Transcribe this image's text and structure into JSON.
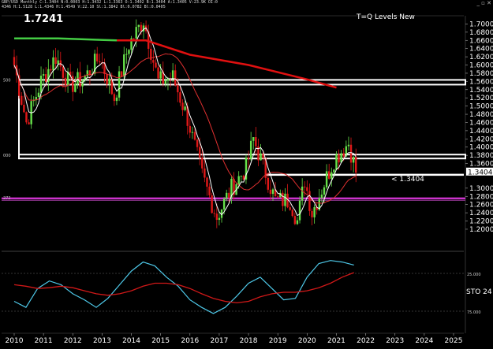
{
  "window": {
    "header_line1": "GBP/USD Monthly  C:1.3404 N:0.0003 H:1.3432 L:1.3363 O:1.3402 B:1.3404 A:1.3405 V:23.9K OI:0",
    "header_line2": "4346  H:1.5128  L:1.4346  H:1.4549  V:22.10 Sl:1.3842  Bl:0.0782  Bl:0.0405",
    "big_price": "1.7241",
    "title": "T=Q Levels New",
    "buttons": "_ ▫ ✕"
  },
  "colors": {
    "background": "#000000",
    "bull": "#66e04a",
    "bear": "#e01818",
    "ma_long": "#e01010",
    "ma_short": "#ffffff",
    "ma_mid": "#e03030",
    "green_ma": "#44cc44",
    "level_box": "#ffffff",
    "magenta_level": "#cc33cc",
    "stoch_k": "#4ec8e8",
    "stoch_d": "#d01818"
  },
  "chart_data": [
    {
      "type": "candlestick",
      "title": "T=Q Levels New",
      "symbol": "GBP/USD Monthly",
      "ylim": [
        1.15,
        1.72
      ],
      "y_ticks": [
        "1.7000",
        "1.6800",
        "1.6600",
        "1.6400",
        "1.6200",
        "1.6000",
        "1.5800",
        "1.5600",
        "1.5400",
        "1.5200",
        "1.5000",
        "1.4800",
        "1.4600",
        "1.4400",
        "1.4200",
        "1.4000",
        "1.3800",
        "1.3600",
        "1.3404",
        "1.3000",
        "1.2800",
        "1.2600",
        "1.2400",
        "1.2200",
        "1.2000"
      ],
      "x_ticks": [
        "2010",
        "2011",
        "2012",
        "2013",
        "2014",
        "2015",
        "2016",
        "2017",
        "2018",
        "2019",
        "2020",
        "2021",
        "2022",
        "2023",
        "2024",
        "2025"
      ],
      "last_price": 1.3404,
      "last_price_label": "< 1.3404",
      "levels": [
        {
          "name": "resistance",
          "value": 1.558,
          "left_label": "500"
        },
        {
          "name": "mid",
          "value": 1.378,
          "left_label": "000"
        },
        {
          "name": "support",
          "value": 1.275,
          "left_label": "272"
        }
      ],
      "yearly_close_path": [
        [
          "2010-01",
          1.6
        ],
        [
          "2010-06",
          1.46
        ],
        [
          "2010-12",
          1.56
        ],
        [
          "2011-06",
          1.62
        ],
        [
          "2011-12",
          1.55
        ],
        [
          "2012-06",
          1.57
        ],
        [
          "2012-12",
          1.62
        ],
        [
          "2013-06",
          1.52
        ],
        [
          "2013-12",
          1.65
        ],
        [
          "2014-06",
          1.71
        ],
        [
          "2014-12",
          1.56
        ],
        [
          "2015-06",
          1.57
        ],
        [
          "2015-12",
          1.47
        ],
        [
          "2016-06",
          1.33
        ],
        [
          "2016-12",
          1.23
        ],
        [
          "2017-06",
          1.3
        ],
        [
          "2017-12",
          1.35
        ],
        [
          "2018-03",
          1.42
        ],
        [
          "2018-12",
          1.27
        ],
        [
          "2019-06",
          1.27
        ],
        [
          "2019-09",
          1.22
        ],
        [
          "2019-12",
          1.32
        ],
        [
          "2020-03",
          1.24
        ],
        [
          "2020-12",
          1.37
        ],
        [
          "2021-06",
          1.41
        ],
        [
          "2021-09",
          1.3404
        ]
      ]
    },
    {
      "type": "line",
      "name": "STO",
      "label": "STO  24",
      "y_ticks": [
        "25.000",
        "75.000"
      ],
      "series": [
        {
          "values": [
            38,
            30,
            55,
            65,
            60,
            48,
            40,
            30,
            42,
            60,
            78,
            90,
            85,
            70,
            58,
            40,
            30,
            22,
            30,
            45,
            62,
            70,
            55,
            40,
            42,
            70,
            88,
            92,
            90,
            86
          ]
        },
        {
          "values": [
            60,
            58,
            55,
            56,
            58,
            56,
            52,
            48,
            46,
            48,
            52,
            58,
            62,
            62,
            60,
            55,
            48,
            42,
            38,
            36,
            38,
            44,
            48,
            50,
            50,
            52,
            56,
            62,
            70,
            76
          ]
        }
      ]
    }
  ]
}
